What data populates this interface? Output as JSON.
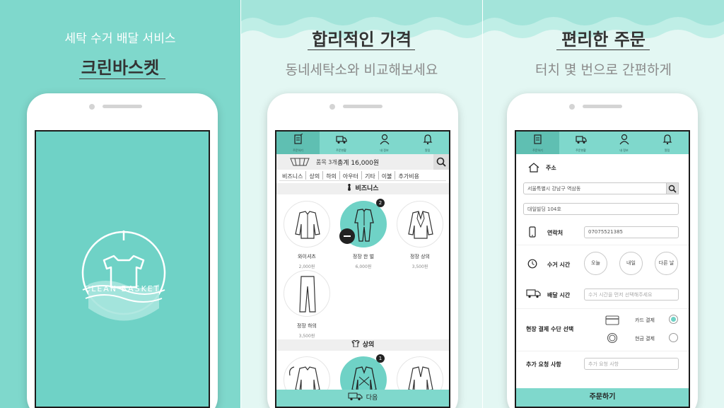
{
  "panel1": {
    "subtitle": "세탁 수거 배달 서비스",
    "title": "크린바스켓",
    "logo_text": "CLEAN BASKET"
  },
  "panel2": {
    "title": "합리적인 가격",
    "subtitle": "동네세탁소와 비교해보세요"
  },
  "panel3": {
    "title": "편리한 주문",
    "subtitle": "터치 몇 번으로 간편하게"
  },
  "tabs": [
    {
      "label": "주문하기",
      "icon": "order-icon"
    },
    {
      "label": "주문현황",
      "icon": "truck-icon"
    },
    {
      "label": "내 정보",
      "icon": "user-icon"
    },
    {
      "label": "알림",
      "icon": "bell-icon"
    }
  ],
  "order_screen": {
    "item_count": "품목 3개",
    "total": "총계 16,000원",
    "categories": [
      "비즈니스",
      "상의",
      "하의",
      "아우터",
      "기타",
      "이불",
      "추가비용"
    ],
    "section1": "비즈니스",
    "section2": "상의",
    "items": [
      {
        "name": "와이셔츠",
        "price": "2,000원",
        "icon": "shirt-icon"
      },
      {
        "name": "정장 한 벌",
        "price": "6,000원",
        "icon": "suit-icon",
        "badge": "2"
      },
      {
        "name": "정장 상의",
        "price": "3,500원",
        "icon": "jacket-icon"
      },
      {
        "name": "정장 하의",
        "price": "3,500원",
        "icon": "pants-icon"
      }
    ],
    "section2_badge": "1",
    "next_label": "다음"
  },
  "checkout_screen": {
    "address_label": "주소",
    "address_value": "서울특별시 강남구 역삼동",
    "address_detail": "대일빌딩 104호",
    "contact_label": "연락처",
    "contact_value": "07075521385",
    "pickup_label": "수거 시간",
    "pickup_options": [
      "오늘",
      "내일",
      "다른 날"
    ],
    "delivery_label": "배달 시간",
    "delivery_placeholder": "수거 시간을 먼저 선택해주세요",
    "payment_label": "현장 결제 수단 선택",
    "payment_card": "카드 결제",
    "payment_cash": "현금 결제",
    "request_label": "추가 요청 사항",
    "request_placeholder": "추가 요청 사항",
    "order_button": "주문하기"
  },
  "colors": {
    "accent": "#7fd8cc",
    "accent_dark": "#5fbfb2",
    "light_bg": "#e3f7f3"
  }
}
